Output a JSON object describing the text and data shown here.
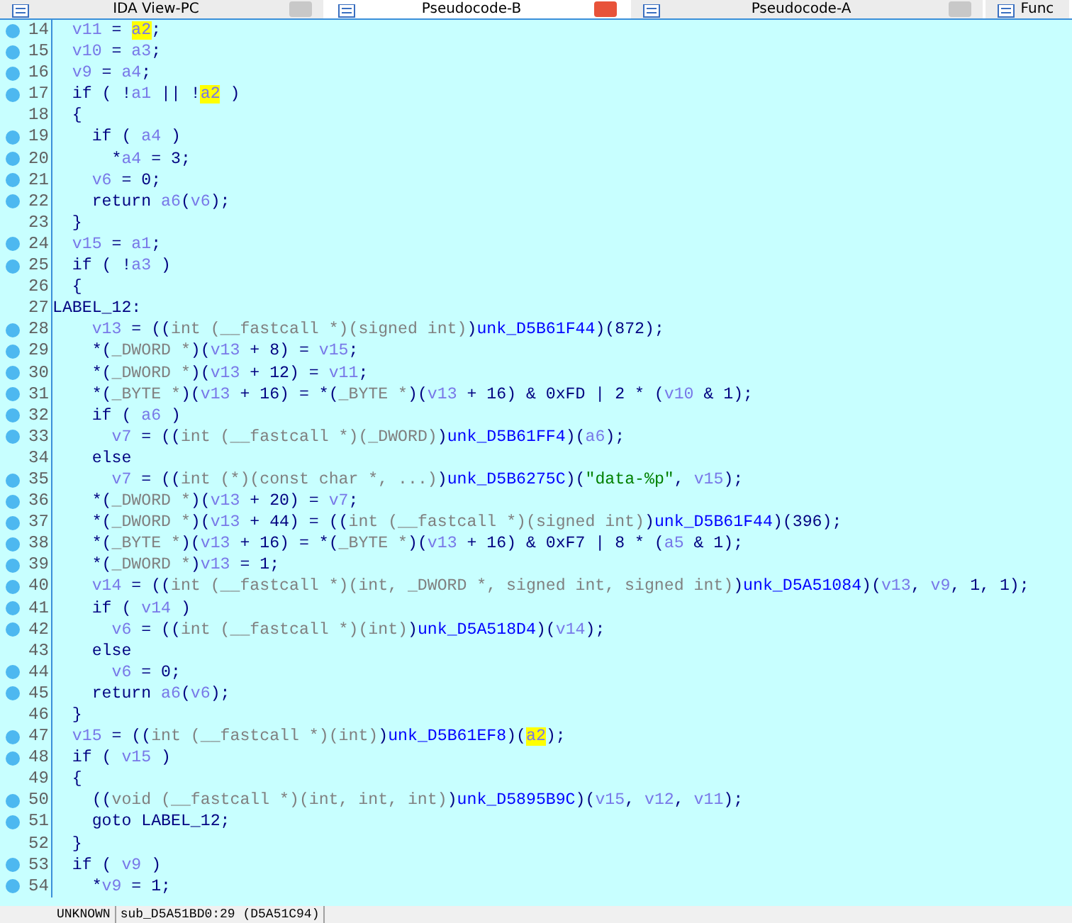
{
  "tabs": [
    {
      "label": "IDA View-PC",
      "selected": false,
      "closable": true
    },
    {
      "label": "Pseudocode-B",
      "selected": true,
      "closable": true
    },
    {
      "label": "Pseudocode-A",
      "selected": false,
      "closable": true
    },
    {
      "label": "Func",
      "selected": false,
      "closable": false
    }
  ],
  "lines": [
    {
      "num": "14",
      "marker": true,
      "segs": [
        {
          "kind": "var",
          "t": "  v11"
        },
        {
          "kind": "plain",
          "t": " = "
        },
        {
          "kind": "hl",
          "t": "a2"
        },
        {
          "kind": "plain",
          "t": ";"
        }
      ]
    },
    {
      "num": "15",
      "marker": true,
      "segs": [
        {
          "kind": "var",
          "t": "  v10"
        },
        {
          "kind": "plain",
          "t": " = "
        },
        {
          "kind": "var",
          "t": "a3"
        },
        {
          "kind": "plain",
          "t": ";"
        }
      ]
    },
    {
      "num": "16",
      "marker": true,
      "segs": [
        {
          "kind": "var",
          "t": "  v9"
        },
        {
          "kind": "plain",
          "t": " = "
        },
        {
          "kind": "var",
          "t": "a4"
        },
        {
          "kind": "plain",
          "t": ";"
        }
      ]
    },
    {
      "num": "17",
      "marker": true,
      "segs": [
        {
          "kind": "plain",
          "t": "  if ( !"
        },
        {
          "kind": "var",
          "t": "a1"
        },
        {
          "kind": "plain",
          "t": " || !"
        },
        {
          "kind": "hl",
          "t": "a2"
        },
        {
          "kind": "plain",
          "t": " )"
        }
      ]
    },
    {
      "num": "18",
      "marker": false,
      "segs": [
        {
          "kind": "plain",
          "t": "  {"
        }
      ]
    },
    {
      "num": "19",
      "marker": true,
      "segs": [
        {
          "kind": "plain",
          "t": "    if ( "
        },
        {
          "kind": "var",
          "t": "a4"
        },
        {
          "kind": "plain",
          "t": " )"
        }
      ]
    },
    {
      "num": "20",
      "marker": true,
      "segs": [
        {
          "kind": "plain",
          "t": "      *"
        },
        {
          "kind": "var",
          "t": "a4"
        },
        {
          "kind": "plain",
          "t": " = 3;"
        }
      ]
    },
    {
      "num": "21",
      "marker": true,
      "segs": [
        {
          "kind": "var",
          "t": "    v6"
        },
        {
          "kind": "plain",
          "t": " = 0;"
        }
      ]
    },
    {
      "num": "22",
      "marker": true,
      "segs": [
        {
          "kind": "plain",
          "t": "    return "
        },
        {
          "kind": "var",
          "t": "a6"
        },
        {
          "kind": "plain",
          "t": "("
        },
        {
          "kind": "var",
          "t": "v6"
        },
        {
          "kind": "plain",
          "t": ");"
        }
      ]
    },
    {
      "num": "23",
      "marker": false,
      "segs": [
        {
          "kind": "plain",
          "t": "  }"
        }
      ]
    },
    {
      "num": "24",
      "marker": true,
      "segs": [
        {
          "kind": "var",
          "t": "  v15"
        },
        {
          "kind": "plain",
          "t": " = "
        },
        {
          "kind": "var",
          "t": "a1"
        },
        {
          "kind": "plain",
          "t": ";"
        }
      ]
    },
    {
      "num": "25",
      "marker": true,
      "segs": [
        {
          "kind": "plain",
          "t": "  if ( !"
        },
        {
          "kind": "var",
          "t": "a3"
        },
        {
          "kind": "plain",
          "t": " )"
        }
      ]
    },
    {
      "num": "26",
      "marker": false,
      "segs": [
        {
          "kind": "plain",
          "t": "  {"
        }
      ]
    },
    {
      "num": "27",
      "marker": false,
      "segs": [
        {
          "kind": "plain",
          "t": "LABEL_12:"
        }
      ]
    },
    {
      "num": "28",
      "marker": true,
      "segs": [
        {
          "kind": "var",
          "t": "    v13"
        },
        {
          "kind": "plain",
          "t": " = (("
        },
        {
          "kind": "cast",
          "t": "int (__fastcall *)(signed int)"
        },
        {
          "kind": "plain",
          "t": ")"
        },
        {
          "kind": "func",
          "t": "unk_D5B61F44"
        },
        {
          "kind": "plain",
          "t": ")(872);"
        }
      ]
    },
    {
      "num": "29",
      "marker": true,
      "segs": [
        {
          "kind": "plain",
          "t": "    *("
        },
        {
          "kind": "cast",
          "t": "_DWORD *"
        },
        {
          "kind": "plain",
          "t": ")("
        },
        {
          "kind": "var",
          "t": "v13"
        },
        {
          "kind": "plain",
          "t": " + 8) = "
        },
        {
          "kind": "var",
          "t": "v15"
        },
        {
          "kind": "plain",
          "t": ";"
        }
      ]
    },
    {
      "num": "30",
      "marker": true,
      "segs": [
        {
          "kind": "plain",
          "t": "    *("
        },
        {
          "kind": "cast",
          "t": "_DWORD *"
        },
        {
          "kind": "plain",
          "t": ")("
        },
        {
          "kind": "var",
          "t": "v13"
        },
        {
          "kind": "plain",
          "t": " + 12) = "
        },
        {
          "kind": "var",
          "t": "v11"
        },
        {
          "kind": "plain",
          "t": ";"
        }
      ]
    },
    {
      "num": "31",
      "marker": true,
      "segs": [
        {
          "kind": "plain",
          "t": "    *("
        },
        {
          "kind": "cast",
          "t": "_BYTE *"
        },
        {
          "kind": "plain",
          "t": ")("
        },
        {
          "kind": "var",
          "t": "v13"
        },
        {
          "kind": "plain",
          "t": " + 16) = *("
        },
        {
          "kind": "cast",
          "t": "_BYTE *"
        },
        {
          "kind": "plain",
          "t": ")("
        },
        {
          "kind": "var",
          "t": "v13"
        },
        {
          "kind": "plain",
          "t": " + 16) & 0xFD | 2 * ("
        },
        {
          "kind": "var",
          "t": "v10"
        },
        {
          "kind": "plain",
          "t": " & 1);"
        }
      ]
    },
    {
      "num": "32",
      "marker": true,
      "segs": [
        {
          "kind": "plain",
          "t": "    if ( "
        },
        {
          "kind": "var",
          "t": "a6"
        },
        {
          "kind": "plain",
          "t": " )"
        }
      ]
    },
    {
      "num": "33",
      "marker": true,
      "segs": [
        {
          "kind": "var",
          "t": "      v7"
        },
        {
          "kind": "plain",
          "t": " = (("
        },
        {
          "kind": "cast",
          "t": "int (__fastcall *)(_DWORD)"
        },
        {
          "kind": "plain",
          "t": ")"
        },
        {
          "kind": "func",
          "t": "unk_D5B61FF4"
        },
        {
          "kind": "plain",
          "t": ")("
        },
        {
          "kind": "var",
          "t": "a6"
        },
        {
          "kind": "plain",
          "t": ");"
        }
      ]
    },
    {
      "num": "34",
      "marker": false,
      "segs": [
        {
          "kind": "plain",
          "t": "    else"
        }
      ]
    },
    {
      "num": "35",
      "marker": true,
      "segs": [
        {
          "kind": "var",
          "t": "      v7"
        },
        {
          "kind": "plain",
          "t": " = (("
        },
        {
          "kind": "cast",
          "t": "int (*)(const char *, ...)"
        },
        {
          "kind": "plain",
          "t": ")"
        },
        {
          "kind": "func",
          "t": "unk_D5B6275C"
        },
        {
          "kind": "plain",
          "t": ")("
        },
        {
          "kind": "str",
          "t": "\"data-%p\""
        },
        {
          "kind": "plain",
          "t": ", "
        },
        {
          "kind": "var",
          "t": "v15"
        },
        {
          "kind": "plain",
          "t": ");"
        }
      ]
    },
    {
      "num": "36",
      "marker": true,
      "segs": [
        {
          "kind": "plain",
          "t": "    *("
        },
        {
          "kind": "cast",
          "t": "_DWORD *"
        },
        {
          "kind": "plain",
          "t": ")("
        },
        {
          "kind": "var",
          "t": "v13"
        },
        {
          "kind": "plain",
          "t": " + 20) = "
        },
        {
          "kind": "var",
          "t": "v7"
        },
        {
          "kind": "plain",
          "t": ";"
        }
      ]
    },
    {
      "num": "37",
      "marker": true,
      "segs": [
        {
          "kind": "plain",
          "t": "    *("
        },
        {
          "kind": "cast",
          "t": "_DWORD *"
        },
        {
          "kind": "plain",
          "t": ")("
        },
        {
          "kind": "var",
          "t": "v13"
        },
        {
          "kind": "plain",
          "t": " + 44) = (("
        },
        {
          "kind": "cast",
          "t": "int (__fastcall *)(signed int)"
        },
        {
          "kind": "plain",
          "t": ")"
        },
        {
          "kind": "func",
          "t": "unk_D5B61F44"
        },
        {
          "kind": "plain",
          "t": ")(396);"
        }
      ]
    },
    {
      "num": "38",
      "marker": true,
      "segs": [
        {
          "kind": "plain",
          "t": "    *("
        },
        {
          "kind": "cast",
          "t": "_BYTE *"
        },
        {
          "kind": "plain",
          "t": ")("
        },
        {
          "kind": "var",
          "t": "v13"
        },
        {
          "kind": "plain",
          "t": " + 16) = *("
        },
        {
          "kind": "cast",
          "t": "_BYTE *"
        },
        {
          "kind": "plain",
          "t": ")("
        },
        {
          "kind": "var",
          "t": "v13"
        },
        {
          "kind": "plain",
          "t": " + 16) & 0xF7 | 8 * ("
        },
        {
          "kind": "var",
          "t": "a5"
        },
        {
          "kind": "plain",
          "t": " & 1);"
        }
      ]
    },
    {
      "num": "39",
      "marker": true,
      "segs": [
        {
          "kind": "plain",
          "t": "    *("
        },
        {
          "kind": "cast",
          "t": "_DWORD *"
        },
        {
          "kind": "plain",
          "t": ")"
        },
        {
          "kind": "var",
          "t": "v13"
        },
        {
          "kind": "plain",
          "t": " = 1;"
        }
      ]
    },
    {
      "num": "40",
      "marker": true,
      "segs": [
        {
          "kind": "var",
          "t": "    v14"
        },
        {
          "kind": "plain",
          "t": " = (("
        },
        {
          "kind": "cast",
          "t": "int (__fastcall *)(int, _DWORD *, signed int, signed int)"
        },
        {
          "kind": "plain",
          "t": ")"
        },
        {
          "kind": "func",
          "t": "unk_D5A51084"
        },
        {
          "kind": "plain",
          "t": ")("
        },
        {
          "kind": "var",
          "t": "v13"
        },
        {
          "kind": "plain",
          "t": ", "
        },
        {
          "kind": "var",
          "t": "v9"
        },
        {
          "kind": "plain",
          "t": ", 1, 1);"
        }
      ]
    },
    {
      "num": "41",
      "marker": true,
      "segs": [
        {
          "kind": "plain",
          "t": "    if ( "
        },
        {
          "kind": "var",
          "t": "v14"
        },
        {
          "kind": "plain",
          "t": " )"
        }
      ]
    },
    {
      "num": "42",
      "marker": true,
      "segs": [
        {
          "kind": "var",
          "t": "      v6"
        },
        {
          "kind": "plain",
          "t": " = (("
        },
        {
          "kind": "cast",
          "t": "int (__fastcall *)(int)"
        },
        {
          "kind": "plain",
          "t": ")"
        },
        {
          "kind": "func",
          "t": "unk_D5A518D4"
        },
        {
          "kind": "plain",
          "t": ")("
        },
        {
          "kind": "var",
          "t": "v14"
        },
        {
          "kind": "plain",
          "t": ");"
        }
      ]
    },
    {
      "num": "43",
      "marker": false,
      "segs": [
        {
          "kind": "plain",
          "t": "    else"
        }
      ]
    },
    {
      "num": "44",
      "marker": true,
      "segs": [
        {
          "kind": "var",
          "t": "      v6"
        },
        {
          "kind": "plain",
          "t": " = 0;"
        }
      ]
    },
    {
      "num": "45",
      "marker": true,
      "segs": [
        {
          "kind": "plain",
          "t": "    return "
        },
        {
          "kind": "var",
          "t": "a6"
        },
        {
          "kind": "plain",
          "t": "("
        },
        {
          "kind": "var",
          "t": "v6"
        },
        {
          "kind": "plain",
          "t": ");"
        }
      ]
    },
    {
      "num": "46",
      "marker": false,
      "segs": [
        {
          "kind": "plain",
          "t": "  }"
        }
      ]
    },
    {
      "num": "47",
      "marker": true,
      "segs": [
        {
          "kind": "var",
          "t": "  v15"
        },
        {
          "kind": "plain",
          "t": " = (("
        },
        {
          "kind": "cast",
          "t": "int (__fastcall *)(int)"
        },
        {
          "kind": "plain",
          "t": ")"
        },
        {
          "kind": "func",
          "t": "unk_D5B61EF8"
        },
        {
          "kind": "plain",
          "t": ")("
        },
        {
          "kind": "hl",
          "t": "a2"
        },
        {
          "kind": "plain",
          "t": ");"
        }
      ]
    },
    {
      "num": "48",
      "marker": true,
      "segs": [
        {
          "kind": "plain",
          "t": "  if ( "
        },
        {
          "kind": "var",
          "t": "v15"
        },
        {
          "kind": "plain",
          "t": " )"
        }
      ]
    },
    {
      "num": "49",
      "marker": false,
      "segs": [
        {
          "kind": "plain",
          "t": "  {"
        }
      ]
    },
    {
      "num": "50",
      "marker": true,
      "segs": [
        {
          "kind": "plain",
          "t": "    (("
        },
        {
          "kind": "cast",
          "t": "void (__fastcall *)(int, int, int)"
        },
        {
          "kind": "plain",
          "t": ")"
        },
        {
          "kind": "func",
          "t": "unk_D5895B9C"
        },
        {
          "kind": "plain",
          "t": ")("
        },
        {
          "kind": "var",
          "t": "v15"
        },
        {
          "kind": "plain",
          "t": ", "
        },
        {
          "kind": "var",
          "t": "v12"
        },
        {
          "kind": "plain",
          "t": ", "
        },
        {
          "kind": "var",
          "t": "v11"
        },
        {
          "kind": "plain",
          "t": ");"
        }
      ]
    },
    {
      "num": "51",
      "marker": true,
      "segs": [
        {
          "kind": "plain",
          "t": "    goto LABEL_12;"
        }
      ]
    },
    {
      "num": "52",
      "marker": false,
      "segs": [
        {
          "kind": "plain",
          "t": "  }"
        }
      ]
    },
    {
      "num": "53",
      "marker": true,
      "segs": [
        {
          "kind": "plain",
          "t": "  if ( "
        },
        {
          "kind": "var",
          "t": "v9"
        },
        {
          "kind": "plain",
          "t": " )"
        }
      ]
    },
    {
      "num": "54",
      "marker": true,
      "segs": [
        {
          "kind": "plain",
          "t": "    *"
        },
        {
          "kind": "var",
          "t": "v9"
        },
        {
          "kind": "plain",
          "t": " = 1;"
        }
      ]
    }
  ],
  "status_bar": {
    "mode": "UNKNOWN",
    "location": "sub_D5A51BD0:29 (D5A51C94)"
  }
}
